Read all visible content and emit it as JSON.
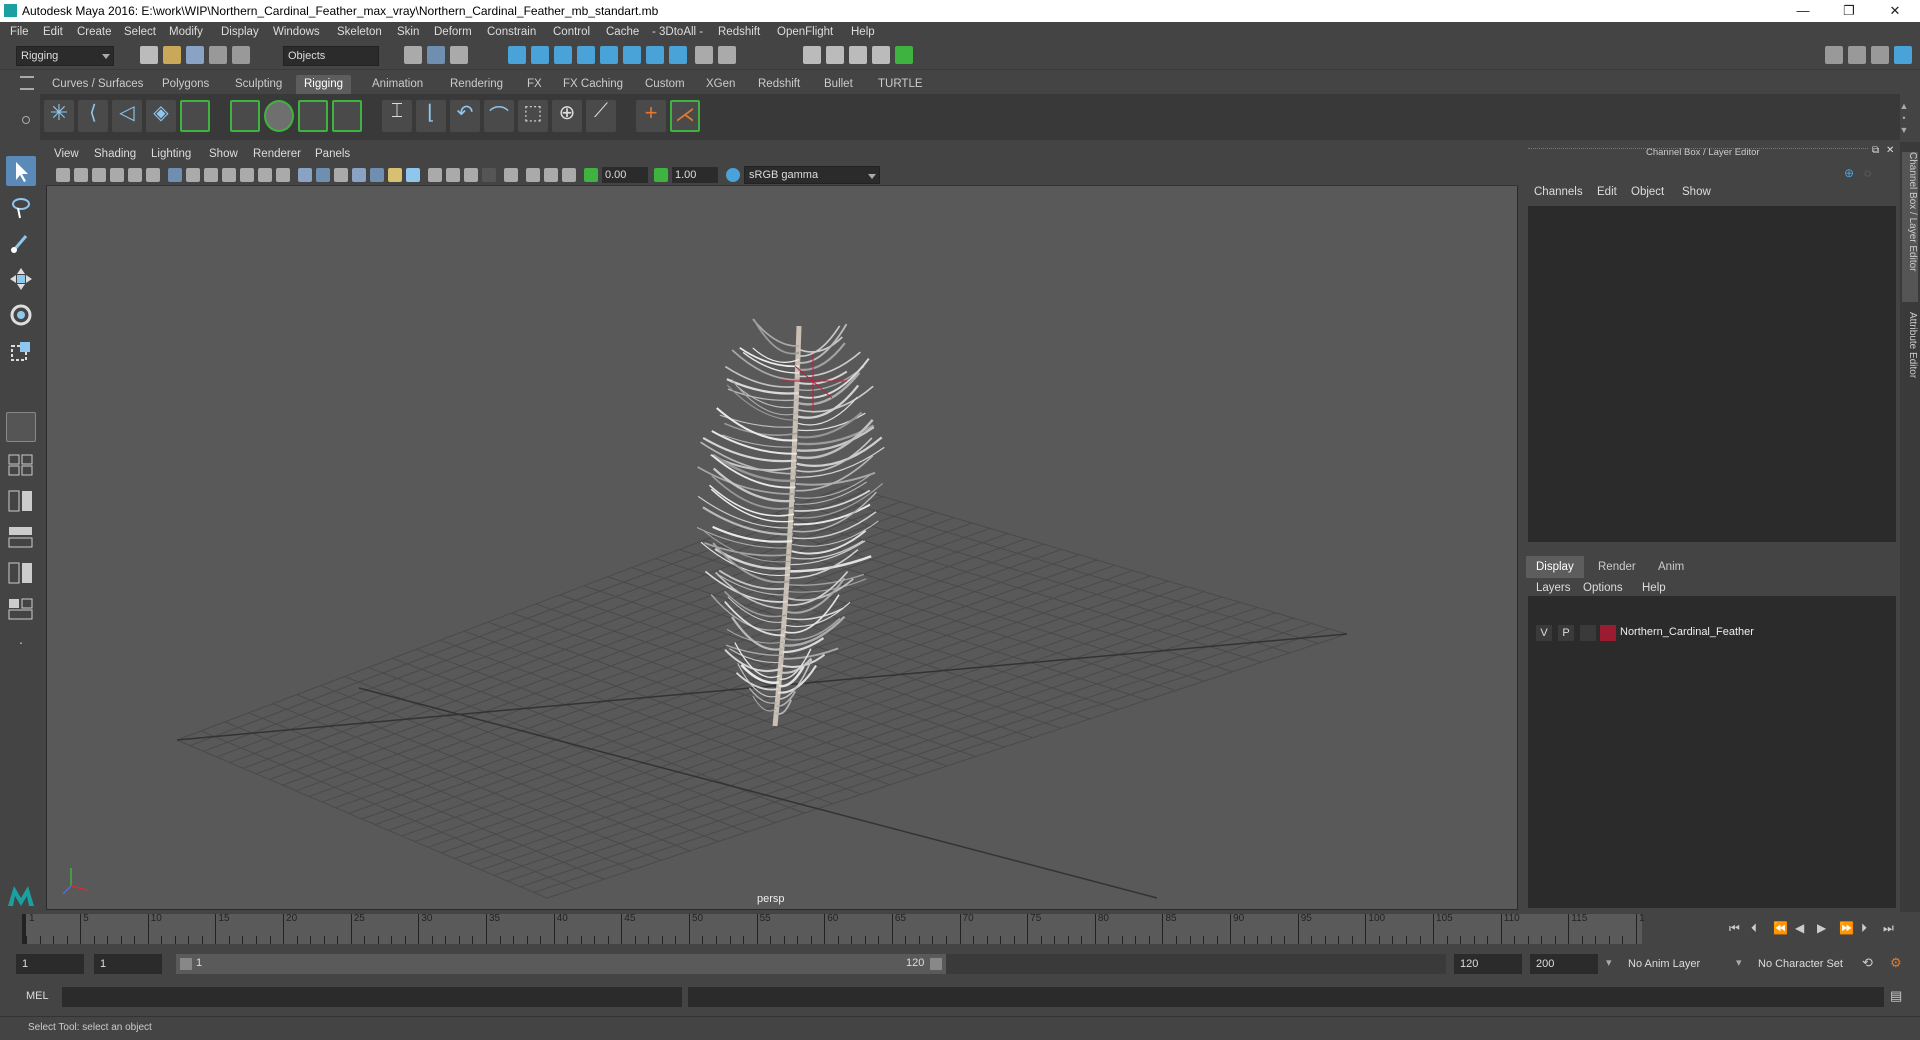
{
  "window": {
    "title": "Autodesk Maya 2016: E:\\work\\WIP\\Northern_Cardinal_Feather_max_vray\\Northern_Cardinal_Feather_mb_standart.mb",
    "minimize": "—",
    "restore": "❐",
    "close": "✕"
  },
  "menubar": [
    "File",
    "Edit",
    "Create",
    "Select",
    "Modify",
    "Display",
    "Windows",
    "Skeleton",
    "Skin",
    "Deform",
    "Constrain",
    "Control",
    "Cache",
    "- 3DtoAll -",
    "Redshift",
    "OpenFlight",
    "Help"
  ],
  "statusline": {
    "menuset": "Rigging",
    "selection_mode": "Objects"
  },
  "shelf_tabs": [
    {
      "label": "Curves / Surfaces"
    },
    {
      "label": "Polygons"
    },
    {
      "label": "Sculpting"
    },
    {
      "label": "Rigging",
      "active": true
    },
    {
      "label": "Animation"
    },
    {
      "label": "Rendering"
    },
    {
      "label": "FX"
    },
    {
      "label": "FX Caching"
    },
    {
      "label": "Custom"
    },
    {
      "label": "XGen"
    },
    {
      "label": "Redshift"
    },
    {
      "label": "Bullet"
    },
    {
      "label": "TURTLE"
    }
  ],
  "panel_menu": [
    "View",
    "Shading",
    "Lighting",
    "Show",
    "Renderer",
    "Panels"
  ],
  "panel_toolbar": {
    "exposure": "0.00",
    "gamma": "1.00",
    "color_space": "sRGB gamma"
  },
  "viewport": {
    "camera_label": "persp"
  },
  "channel_box": {
    "title": "Channel Box / Layer Editor",
    "menu": [
      "Channels",
      "Edit",
      "Object",
      "Show"
    ]
  },
  "layer_editor": {
    "tabs": [
      {
        "label": "Display",
        "active": true
      },
      {
        "label": "Render"
      },
      {
        "label": "Anim"
      }
    ],
    "menu": [
      "Layers",
      "Options",
      "Help"
    ],
    "layers": [
      {
        "visible": "V",
        "playback": "P",
        "color": "#9b1b30",
        "name": "Northern_Cardinal_Feather"
      }
    ]
  },
  "side_tabs": [
    "Channel Box / Layer Editor",
    "Attribute Editor"
  ],
  "timeline": {
    "ticks": [
      "1",
      "5",
      "10",
      "15",
      "20",
      "25",
      "30",
      "35",
      "40",
      "45",
      "50",
      "55",
      "60",
      "65",
      "70",
      "75",
      "80",
      "85",
      "90",
      "95",
      "100",
      "105",
      "110",
      "115",
      "120"
    ],
    "current_frame": "1"
  },
  "range": {
    "start": "1",
    "playback_start": "1",
    "slider_start": "1",
    "slider_end": "120",
    "playback_end": "120",
    "end": "200",
    "anim_layer": "No Anim Layer",
    "character_set": "No Character Set"
  },
  "command_line": {
    "mode": "MEL"
  },
  "help_line": "Select Tool: select an object",
  "icons": {
    "accent_green": "#3fb33f",
    "accent_blue": "#4aa3d8",
    "accent_orange": "#e07a30"
  }
}
